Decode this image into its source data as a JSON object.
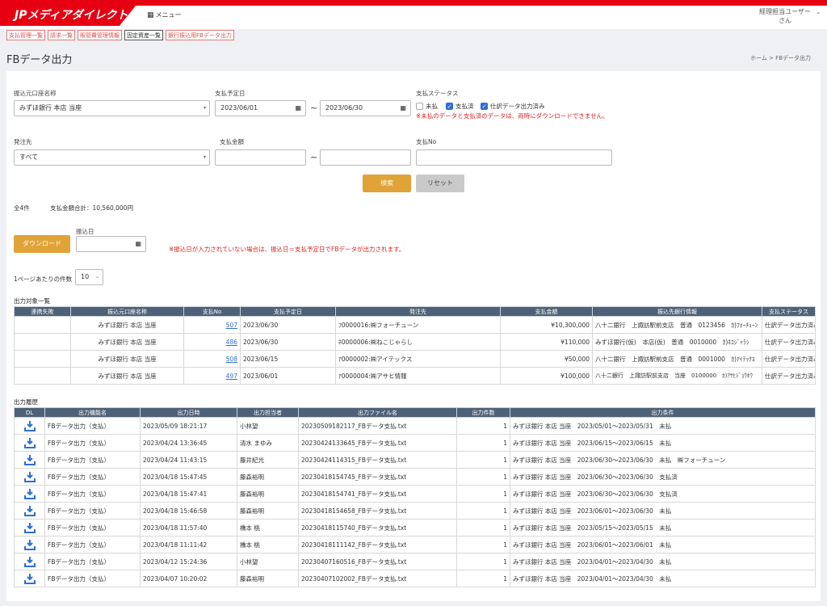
{
  "header": {
    "logo": "JPメディアダイレクト",
    "menu_label": "メニュー",
    "user_line1": "経理担当ユーザー",
    "user_line2": "さん"
  },
  "tabs": [
    "支払管理一覧",
    "請求一覧",
    "販管費管理情報",
    "固定資産一覧",
    "銀行振込用FBデータ出力"
  ],
  "page_title": "FBデータ出力",
  "breadcrumb": "ホーム > FBデータ出力",
  "form": {
    "source_account_label": "振込元口座名称",
    "source_account_value": "みずほ銀行 本店 当座",
    "due_date_label": "支払予定日",
    "due_date_from": "2023/06/01",
    "due_date_to": "2023/06/30",
    "tilde": "~",
    "status_label": "支払ステータス",
    "status_options": [
      {
        "label": "未払",
        "checked": false
      },
      {
        "label": "支払済",
        "checked": true
      },
      {
        "label": "仕訳データ出力済み",
        "checked": true
      }
    ],
    "status_warning": "※未払のデータと支払済のデータは、両時にダウンロードできません。",
    "vendor_label": "発注先",
    "vendor_value": "すべて",
    "amount_label": "支払金額",
    "payno_label": "支払No",
    "search_button": "検索",
    "reset_button": "リセット"
  },
  "summary": {
    "count": "全4件",
    "total": "支払金額合計：10,560,000円"
  },
  "download": {
    "button": "ダウンロード",
    "date_label": "振込日",
    "warning": "※振込日が入力されていない場合は、振込日＝支払予定日でFBデータが出力されます。"
  },
  "paging": {
    "label": "1ページあたりの件数",
    "value": "10"
  },
  "targets": {
    "title": "出力対象一覧",
    "headers": [
      "連携失敗",
      "振込元口座名称",
      "支払No",
      "支払予定日",
      "発注先",
      "支払金額",
      "振込先銀行情報",
      "支払ステータス"
    ],
    "rows": [
      {
        "fail": "",
        "account": "みずほ銀行 本店 当座",
        "no": "507",
        "date": "2023/06/30",
        "vendor": "ﾌ0000016:㈱フォーチューン",
        "amount": "¥10,300,000",
        "bank": "八十二銀行　上諏訪駅前支店　普通　0123456　ｶ)ﾌｫｰﾁｭｰﾝ",
        "status": "仕訳データ出力済み"
      },
      {
        "fail": "",
        "account": "みずほ銀行 本店 当座",
        "no": "486",
        "date": "2023/06/30",
        "vendor": "ﾈ0000006:㈱ねこじゃらし",
        "amount": "¥110,000",
        "bank": "みずほ銀行(仮)　本店(仮)　普通　0010000　ｶ)ﾈｺｼﾞｬﾗｼ",
        "status": "仕訳データ出力済み"
      },
      {
        "fail": "",
        "account": "みずほ銀行 本店 当座",
        "no": "508",
        "date": "2023/06/15",
        "vendor": "ｱ0000002:㈱アイテックス",
        "amount": "¥50,000",
        "bank": "八十二銀行　上諏訪駅前支店　普通　0001000　ｶ)ｱｲﾃｯｸｽ",
        "status": "仕訳データ出力済み"
      },
      {
        "fail": "",
        "account": "みずほ銀行 本店 当座",
        "no": "497",
        "date": "2023/06/01",
        "vendor": "ｱ0000004:㈱アサヒ情報",
        "amount": "¥100,000",
        "bank": "八十二銀行　上諏訪駅前支店　当座　0100000　ｶ)ｱｻﾋｼﾞｮｳﾎｳ",
        "status": "仕訳データ出力済み"
      }
    ]
  },
  "history": {
    "title": "出力履歴",
    "headers": [
      "DL",
      "出力機能名",
      "出力日時",
      "出力担当者",
      "出力ファイル名",
      "出力件数",
      "出力条件"
    ],
    "rows": [
      {
        "fn": "FBデータ出力（支払）",
        "at": "2023/05/09 18:21:17",
        "by": "小林望",
        "file": "20230509182117_FBデータ支払.txt",
        "n": "1",
        "cond": "みずほ銀行 本店 当座　2023/05/01〜2023/05/31　未払"
      },
      {
        "fn": "FBデータ出力（支払）",
        "at": "2023/04/24 13:36:45",
        "by": "清水 まゆみ",
        "file": "20230424133645_FBデータ支払.txt",
        "n": "1",
        "cond": "みずほ銀行 本店 当座　2023/06/15〜2023/06/15　未払"
      },
      {
        "fn": "FBデータ出力（支払）",
        "at": "2023/04/24 11:43:15",
        "by": "藤井紀光",
        "file": "20230424114315_FBデータ支払.txt",
        "n": "1",
        "cond": "みずほ銀行 本店 当座　2023/06/30〜2023/06/30　未払　㈱フォーチューン"
      },
      {
        "fn": "FBデータ出力（支払）",
        "at": "2023/04/18 15:47:45",
        "by": "藤森裕明",
        "file": "20230418154745_FBデータ支払.txt",
        "n": "1",
        "cond": "みずほ銀行 本店 当座　2023/06/30〜2023/06/30　支払済"
      },
      {
        "fn": "FBデータ出力（支払）",
        "at": "2023/04/18 15:47:41",
        "by": "藤森裕明",
        "file": "20230418154741_FBデータ支払.txt",
        "n": "1",
        "cond": "みずほ銀行 本店 当座　2023/06/30〜2023/06/30　支払済"
      },
      {
        "fn": "FBデータ出力（支払）",
        "at": "2023/04/18 15:46:58",
        "by": "藤森裕明",
        "file": "20230418154658_FBデータ支払.txt",
        "n": "1",
        "cond": "みずほ銀行 本店 当座　2023/06/01〜2023/06/30　未払"
      },
      {
        "fn": "FBデータ出力（支払）",
        "at": "2023/04/18 11:57:40",
        "by": "橋本 桃",
        "file": "20230418115740_FBデータ支払.txt",
        "n": "1",
        "cond": "みずほ銀行 本店 当座　2023/05/15〜2023/05/15　未払"
      },
      {
        "fn": "FBデータ出力（支払）",
        "at": "2023/04/18 11:11:42",
        "by": "橋本 桃",
        "file": "20230418111142_FBデータ支払.txt",
        "n": "1",
        "cond": "みずほ銀行 本店 当座　2023/06/01〜2023/06/01　未払"
      },
      {
        "fn": "FBデータ出力（支払）",
        "at": "2023/04/12 15:24:36",
        "by": "小林望",
        "file": "20230407160516_FBデータ支払.txt",
        "n": "1",
        "cond": "みずほ銀行 本店 当座　2023/04/01〜2023/04/30　未払"
      },
      {
        "fn": "FBデータ出力（支払）",
        "at": "2023/04/07 10:20:02",
        "by": "藤森裕明",
        "file": "20230407102002_FBデータ支払.txt",
        "n": "1",
        "cond": "みずほ銀行 本店 当座　2023/04/01〜2023/04/30　未払"
      }
    ]
  },
  "colors": {
    "brand_red": "#e60012",
    "accent_orange": "#e0a338",
    "table_header": "#4f6178",
    "link_blue": "#2f6fd1",
    "warning_red": "#e02020"
  }
}
